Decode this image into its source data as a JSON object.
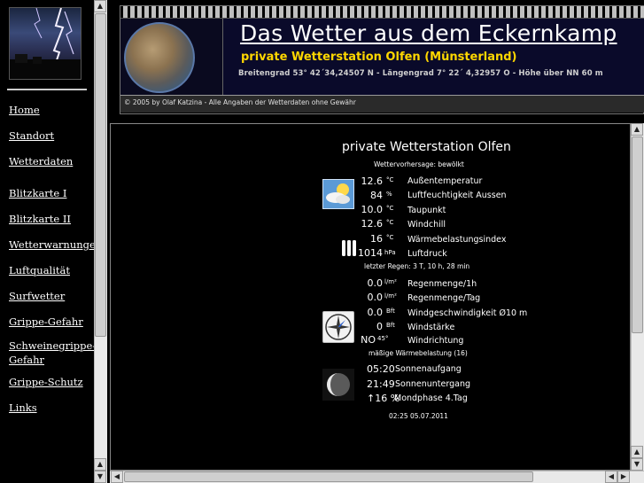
{
  "nav": {
    "items": [
      {
        "label": "Home"
      },
      {
        "label": "Standort"
      },
      {
        "label": "Wetterdaten"
      },
      {
        "label": "Blitzkarte I"
      },
      {
        "label": "Blitzkarte II"
      },
      {
        "label": "Wetterwarnungen"
      },
      {
        "label": "Luftqualität"
      },
      {
        "label": "Surfwetter"
      },
      {
        "label": "Grippe-Gefahr"
      },
      {
        "label": "Schweinegrippe-Gefahr"
      },
      {
        "label": "Grippe-Schutz"
      },
      {
        "label": "Links"
      }
    ]
  },
  "header": {
    "title": "Das Wetter aus dem Eckernkamp",
    "subtitle": "private Wetterstation Olfen (Münsterland)",
    "coords": "Breitengrad  53° 42´34,24507 N   -   Längengrad  7° 22´ 4,32957 O   -   Höhe über NN    60 m",
    "copyright": "© 2005 by Olaf Katzina - Alle Angaben der Wetterdaten ohne Gewähr"
  },
  "weather": {
    "station_title": "private Wetterstation Olfen",
    "forecast": "Wettervorhersage: bewölkt",
    "rows_a": [
      {
        "value": "12.6",
        "unit": "°C",
        "label": "Außentemperatur"
      },
      {
        "value": "84",
        "unit": "%",
        "label": "Luftfeuchtigkeit Aussen"
      },
      {
        "value": "10.0",
        "unit": "°C",
        "label": "Taupunkt"
      },
      {
        "value": "12.6",
        "unit": "°C",
        "label": "Windchill"
      },
      {
        "value": "16",
        "unit": "°C",
        "label": "Wärmebelastungsindex"
      },
      {
        "value": "1014",
        "unit": "hPa",
        "label": "Luftdruck"
      }
    ],
    "last_rain": "letzter Regen:  3 T, 10 h, 28 min",
    "rows_b": [
      {
        "value": "0.0",
        "unit": "l/m²",
        "label": "Regenmenge/1h"
      },
      {
        "value": "0.0",
        "unit": "l/m²",
        "label": "Regenmenge/Tag"
      },
      {
        "value": "0.0",
        "unit": "Bft",
        "label": "Windgeschwindigkeit Ø10 m"
      },
      {
        "value": "0",
        "unit": "Bft",
        "label": "Windstärke"
      },
      {
        "value": "NO",
        "unit": "45°",
        "label": "Windrichtung"
      }
    ],
    "heat_load": "mäßige Wärmebelastung (16)",
    "sunrise_time": "05:20",
    "sunrise_label": "Sonnenaufgang",
    "sunset_time": "21:49",
    "sunset_label": "Sonnenuntergang",
    "moon_value": "↑16 %",
    "moon_label": "Mondphase 4.Tag",
    "timestamp": "02:25  05.07.2011"
  },
  "icons": {
    "weather": "cloud-sun-icon",
    "pressure": "pressure-bars-icon",
    "compass": "compass-icon",
    "moon": "moon-icon"
  },
  "colors": {
    "subtitle": "#ffd700",
    "header_bg": "#0a0a2a",
    "page_bg": "#000000"
  }
}
